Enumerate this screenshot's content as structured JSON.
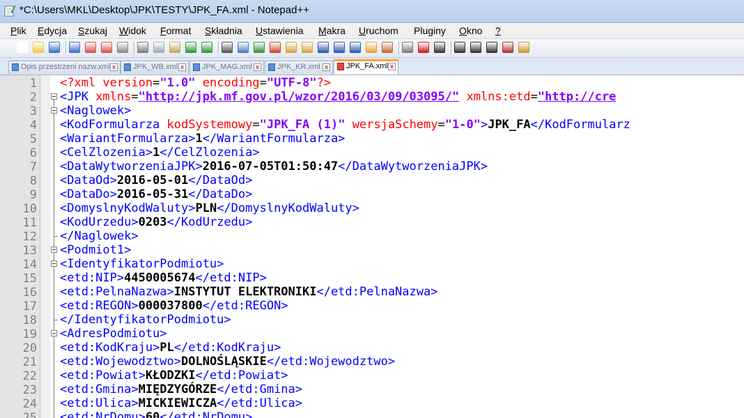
{
  "window": {
    "title": "*C:\\Users\\MKL\\Desktop\\JPK\\TESTY\\JPK_FA.xml - Notepad++"
  },
  "menu": [
    {
      "ul": "P",
      "rest": "lik"
    },
    {
      "ul": "E",
      "rest": "dycja"
    },
    {
      "ul": "S",
      "rest": "zukaj"
    },
    {
      "ul": "W",
      "rest": "idok"
    },
    {
      "ul": "F",
      "rest": "ormat"
    },
    {
      "ul": "S",
      "rest": "kładnia",
      "pre": ""
    },
    {
      "ul": "U",
      "rest": "stawienia"
    },
    {
      "ul": "M",
      "rest": "akra"
    },
    {
      "ul": "U",
      "rest": "ruchom"
    },
    {
      "ul": "",
      "rest": "Pluginy"
    },
    {
      "ul": "O",
      "rest": "kno"
    },
    {
      "ul": "?",
      "rest": ""
    }
  ],
  "toolbar_icons": [
    "new-file-icon",
    "open-file-icon",
    "save-icon",
    "save-all-icon",
    "close-icon",
    "close-all-icon",
    "print-icon",
    "cut-icon",
    "copy-icon",
    "paste-icon",
    "undo-icon",
    "redo-icon",
    "find-icon",
    "replace-icon",
    "zoom-in-icon",
    "zoom-out-icon",
    "sync-vertical-icon",
    "sync-horizontal-icon",
    "word-wrap-icon",
    "show-all-chars-icon",
    "indent-guide-icon",
    "doc-map-icon",
    "function-list-icon",
    "folder-workspace-icon",
    "record-macro-icon",
    "stop-macro-icon",
    "play-macro-icon",
    "run-macro-multiple-icon",
    "save-macro-icon",
    "spell-check-icon",
    "plugin-icon"
  ],
  "tabs": [
    {
      "label": "Opis przestrzeni nazw.xml",
      "active": false
    },
    {
      "label": "JPK_WB.xml",
      "active": false
    },
    {
      "label": "JPK_MAG.xml",
      "active": false
    },
    {
      "label": "JPK_KR.xml",
      "active": false
    },
    {
      "label": "JPK_FA.xml",
      "active": true
    }
  ],
  "tab_close_glyph": "x",
  "colors": {
    "tag": "#0000ff",
    "attribute": "#ff0000",
    "value": "#8000ff",
    "text": "#000000",
    "active_tab_accent": "#f6a33a"
  },
  "editor": {
    "lines": [
      {
        "n": "1",
        "fold": "none",
        "parts": [
          [
            "decl",
            "<?xml "
          ],
          [
            "attr",
            "version"
          ],
          [
            "eq",
            "="
          ],
          [
            "val",
            "\"1.0\""
          ],
          [
            "decl",
            " "
          ],
          [
            "attr",
            "encoding"
          ],
          [
            "eq",
            "="
          ],
          [
            "val",
            "\"UTF-8\""
          ],
          [
            "decl",
            "?>"
          ]
        ]
      },
      {
        "n": "2",
        "fold": "open",
        "parts": [
          [
            "tag",
            "<JPK "
          ],
          [
            "attr",
            "xmlns"
          ],
          [
            "eq",
            "="
          ],
          [
            "url",
            "\"http://jpk.mf.gov.pl/wzor/2016/03/09/03095/\""
          ],
          [
            "tag",
            " "
          ],
          [
            "attr",
            "xmlns:etd"
          ],
          [
            "eq",
            "="
          ],
          [
            "url",
            "\"http://cre"
          ]
        ]
      },
      {
        "n": "3",
        "fold": "open",
        "parts": [
          [
            "tag",
            "<Naglowek>"
          ]
        ]
      },
      {
        "n": "4",
        "fold": "line",
        "parts": [
          [
            "tag",
            "<KodFormularza "
          ],
          [
            "attr",
            "kodSystemowy"
          ],
          [
            "eq",
            "="
          ],
          [
            "val",
            "\"JPK_FA (1)\""
          ],
          [
            "tag",
            " "
          ],
          [
            "attr",
            "wersjaSchemy"
          ],
          [
            "eq",
            "="
          ],
          [
            "val",
            "\"1-0\""
          ],
          [
            "tag",
            ">"
          ],
          [
            "text",
            "JPK_FA"
          ],
          [
            "tag",
            "</KodFormularz"
          ]
        ]
      },
      {
        "n": "5",
        "fold": "line",
        "parts": [
          [
            "tag",
            "<WariantFormularza>"
          ],
          [
            "text",
            "1"
          ],
          [
            "tag",
            "</WariantFormularza>"
          ]
        ]
      },
      {
        "n": "6",
        "fold": "line",
        "parts": [
          [
            "tag",
            "<CelZlozenia>"
          ],
          [
            "text",
            "1"
          ],
          [
            "tag",
            "</CelZlozenia>"
          ]
        ]
      },
      {
        "n": "7",
        "fold": "line",
        "parts": [
          [
            "tag",
            "<DataWytworzeniaJPK>"
          ],
          [
            "text",
            "2016-07-05T01:50:47"
          ],
          [
            "tag",
            "</DataWytworzeniaJPK>"
          ]
        ]
      },
      {
        "n": "8",
        "fold": "line",
        "parts": [
          [
            "tag",
            "<DataOd>"
          ],
          [
            "text",
            "2016-05-01"
          ],
          [
            "tag",
            "</DataOd>"
          ]
        ]
      },
      {
        "n": "9",
        "fold": "line",
        "parts": [
          [
            "tag",
            "<DataDo>"
          ],
          [
            "text",
            "2016-05-31"
          ],
          [
            "tag",
            "</DataDo>"
          ]
        ]
      },
      {
        "n": "10",
        "fold": "line",
        "parts": [
          [
            "tag",
            "<DomyslnyKodWaluty>"
          ],
          [
            "text",
            "PLN"
          ],
          [
            "tag",
            "</DomyslnyKodWaluty>"
          ]
        ]
      },
      {
        "n": "11",
        "fold": "line",
        "parts": [
          [
            "tag",
            "<KodUrzedu>"
          ],
          [
            "text",
            "0203"
          ],
          [
            "tag",
            "</KodUrzedu>"
          ]
        ]
      },
      {
        "n": "12",
        "fold": "end",
        "parts": [
          [
            "tag",
            "</Naglowek>"
          ]
        ]
      },
      {
        "n": "13",
        "fold": "open",
        "parts": [
          [
            "tag",
            "<Podmiot1>"
          ]
        ]
      },
      {
        "n": "14",
        "fold": "open",
        "parts": [
          [
            "tag",
            "<IdentyfikatorPodmiotu>"
          ]
        ]
      },
      {
        "n": "15",
        "fold": "line",
        "parts": [
          [
            "tag",
            "<etd:NIP>"
          ],
          [
            "text",
            "4450005674"
          ],
          [
            "tag",
            "</etd:NIP>"
          ]
        ]
      },
      {
        "n": "16",
        "fold": "line",
        "parts": [
          [
            "tag",
            "<etd:PelnaNazwa>"
          ],
          [
            "text",
            "INSTYTUT ELEKTRONIKI"
          ],
          [
            "tag",
            "</etd:PelnaNazwa>"
          ]
        ]
      },
      {
        "n": "17",
        "fold": "line",
        "parts": [
          [
            "tag",
            "<etd:REGON>"
          ],
          [
            "text",
            "000037800"
          ],
          [
            "tag",
            "</etd:REGON>"
          ]
        ]
      },
      {
        "n": "18",
        "fold": "end",
        "parts": [
          [
            "tag",
            "</IdentyfikatorPodmiotu>"
          ]
        ]
      },
      {
        "n": "19",
        "fold": "open",
        "parts": [
          [
            "tag",
            "<AdresPodmiotu>"
          ]
        ]
      },
      {
        "n": "20",
        "fold": "line",
        "parts": [
          [
            "tag",
            "<etd:KodKraju>"
          ],
          [
            "text",
            "PL"
          ],
          [
            "tag",
            "</etd:KodKraju>"
          ]
        ]
      },
      {
        "n": "21",
        "fold": "line",
        "parts": [
          [
            "tag",
            "<etd:Wojewodztwo>"
          ],
          [
            "text",
            "DOLNOŚLĄSKIE"
          ],
          [
            "tag",
            "</etd:Wojewodztwo>"
          ]
        ]
      },
      {
        "n": "22",
        "fold": "line",
        "parts": [
          [
            "tag",
            "<etd:Powiat>"
          ],
          [
            "text",
            "KŁODZKI"
          ],
          [
            "tag",
            "</etd:Powiat>"
          ]
        ]
      },
      {
        "n": "23",
        "fold": "line",
        "parts": [
          [
            "tag",
            "<etd:Gmina>"
          ],
          [
            "text",
            "MIĘDZYGÓRZE"
          ],
          [
            "tag",
            "</etd:Gmina>"
          ]
        ]
      },
      {
        "n": "24",
        "fold": "line",
        "parts": [
          [
            "tag",
            "<etd:Ulica>"
          ],
          [
            "text",
            "MICKIEWICZA"
          ],
          [
            "tag",
            "</etd:Ulica>"
          ]
        ]
      },
      {
        "n": "25",
        "fold": "line",
        "parts": [
          [
            "tag",
            "<etd:NrDomu>"
          ],
          [
            "text",
            "60"
          ],
          [
            "tag",
            "</etd:NrDomu>"
          ]
        ]
      }
    ]
  }
}
